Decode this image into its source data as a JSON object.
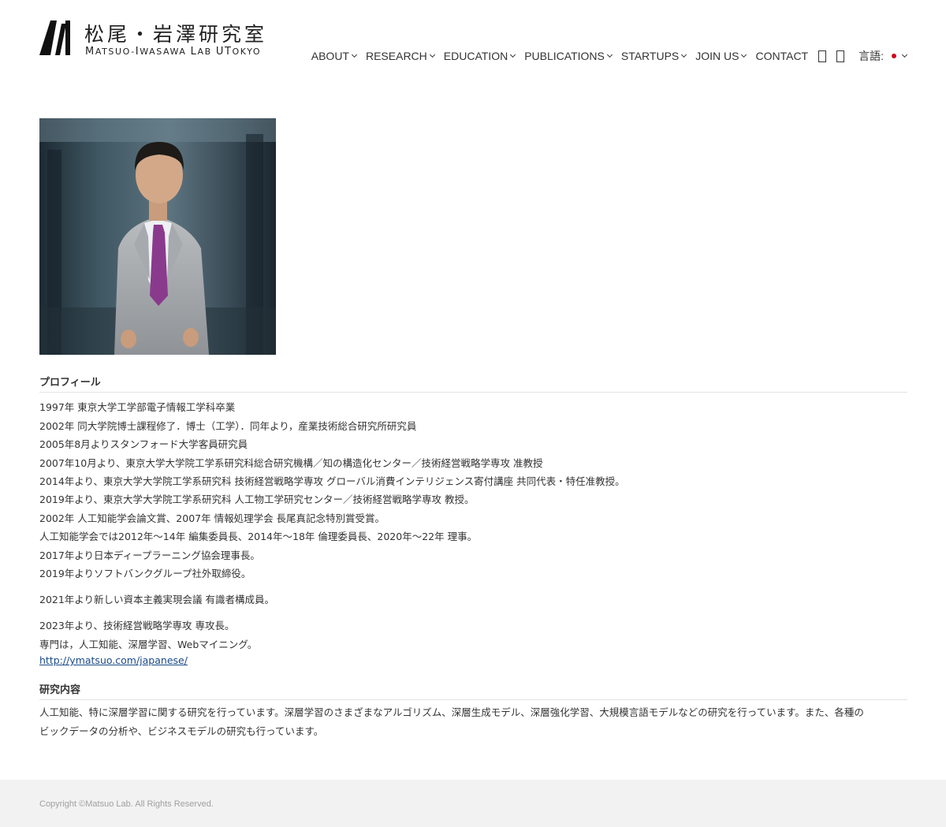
{
  "header": {
    "logo_jp": "松尾・岩澤研究室",
    "logo_en_parts": [
      "M",
      "ATSUO-",
      "I",
      "WASAWA ",
      "L",
      "AB ",
      "UT",
      "OKYO"
    ],
    "nav": [
      {
        "label": "ABOUT",
        "dropdown": true
      },
      {
        "label": "RESEARCH",
        "dropdown": true
      },
      {
        "label": "EDUCATION",
        "dropdown": true
      },
      {
        "label": "PUBLICATIONS",
        "dropdown": true
      },
      {
        "label": "STARTUPS",
        "dropdown": true
      },
      {
        "label": "JOIN US",
        "dropdown": true
      },
      {
        "label": "CONTACT",
        "dropdown": false
      }
    ],
    "icons": [
      "search-icon",
      "menu-icon"
    ],
    "language": {
      "label": "言語:",
      "flag": "japan-flag-icon"
    }
  },
  "profile": {
    "heading": "プロフィール",
    "lines": [
      "1997年 東京大学工学部電子情報工学科卒業",
      "2002年 同大学院博士課程修了．博士（工学）．同年より，産業技術総合研究所研究員",
      "2005年8月よりスタンフォード大学客員研究員",
      "2007年10月より、東京大学大学院工学系研究科総合研究機構／知の構造化センター／技術経営戦略学専攻 准教授",
      "2014年より、東京大学大学院工学系研究科 技術経営戦略学専攻 グローバル消費インテリジェンス寄付講座 共同代表・特任准教授。",
      "2019年より、東京大学大学院工学系研究科 人工物工学研究センター／技術経営戦略学専攻 教授。",
      "2002年 人工知能学会論文賞、2007年 情報処理学会 長尾真記念特別賞受賞。",
      "人工知能学会では2012年〜14年 編集委員長、2014年〜18年 倫理委員長、2020年〜22年 理事。",
      "2017年より日本ディープラーニング協会理事長。",
      "2019年よりソフトバンクグループ社外取締役。"
    ],
    "line_2021": "2021年より新しい資本主義実現会議 有識者構成員。",
    "line_2023": "2023年より、技術経営戦略学専攻 専攻長。",
    "specialty": "専門は，人工知能、深層学習、Webマイニング。",
    "link": "http://ymatsuo.com/japanese/"
  },
  "research": {
    "heading": "研究内容",
    "text_line1": "人工知能、特に深層学習に関する研究を行っています。深層学習のさまざまなアルゴリズム、深層生成モデル、深層強化学習、大規模言語モデルなどの研究を行っています。また、各種の",
    "text_line2": "ビックデータの分析や、ビジネスモデルの研究も行っています。"
  },
  "footer": {
    "copyright": "Copyright ©Matsuo Lab. All Rights Reserved."
  }
}
